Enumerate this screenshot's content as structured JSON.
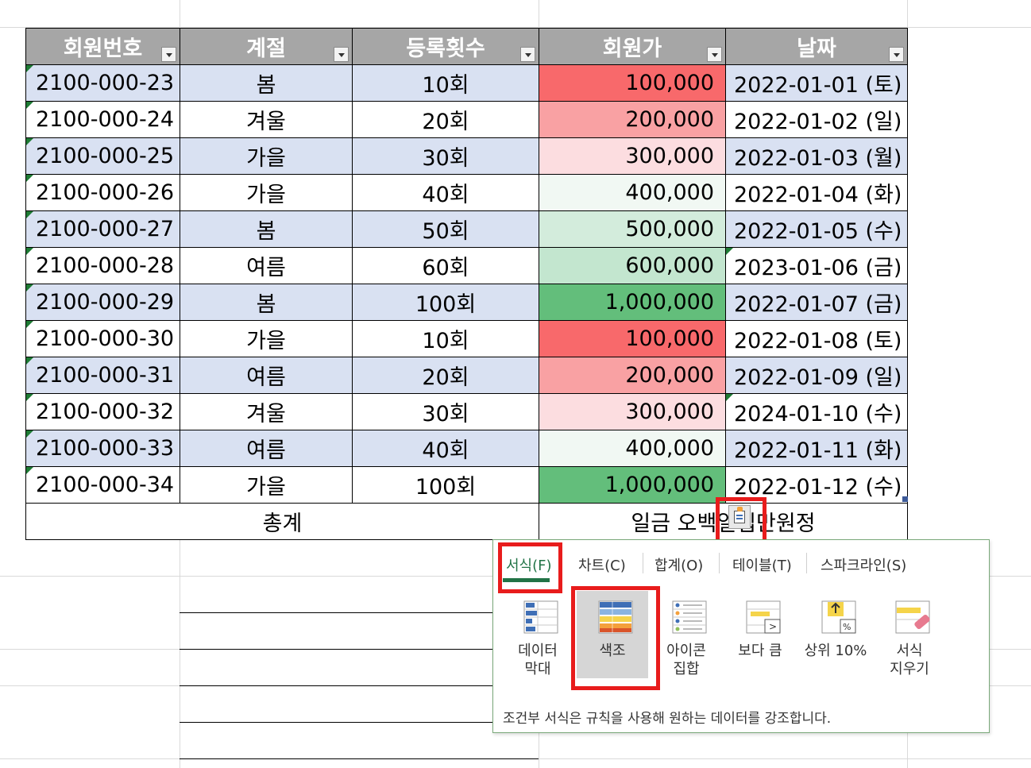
{
  "table": {
    "headers": [
      "회원번호",
      "계절",
      "등록횟수",
      "회원가",
      "날짜"
    ],
    "rows": [
      {
        "id": "2100-000-23",
        "season": "봄",
        "count": "10회",
        "price": "100,000",
        "date": "2022-01-01 (토)"
      },
      {
        "id": "2100-000-24",
        "season": "겨울",
        "count": "20회",
        "price": "200,000",
        "date": "2022-01-02 (일)"
      },
      {
        "id": "2100-000-25",
        "season": "가을",
        "count": "30회",
        "price": "300,000",
        "date": "2022-01-03 (월)"
      },
      {
        "id": "2100-000-26",
        "season": "가을",
        "count": "40회",
        "price": "400,000",
        "date": "2022-01-04 (화)"
      },
      {
        "id": "2100-000-27",
        "season": "봄",
        "count": "50회",
        "price": "500,000",
        "date": "2022-01-05 (수)"
      },
      {
        "id": "2100-000-28",
        "season": "여름",
        "count": "60회",
        "price": "600,000",
        "date": "2023-01-06 (금)"
      },
      {
        "id": "2100-000-29",
        "season": "봄",
        "count": "100회",
        "price": "1,000,000",
        "date": "2022-01-07 (금)"
      },
      {
        "id": "2100-000-30",
        "season": "가을",
        "count": "10회",
        "price": "100,000",
        "date": "2022-01-08 (토)"
      },
      {
        "id": "2100-000-31",
        "season": "여름",
        "count": "20회",
        "price": "200,000",
        "date": "2022-01-09 (일)"
      },
      {
        "id": "2100-000-32",
        "season": "겨울",
        "count": "30회",
        "price": "300,000",
        "date": "2024-01-10 (수)"
      },
      {
        "id": "2100-000-33",
        "season": "여름",
        "count": "40회",
        "price": "400,000",
        "date": "2022-01-11 (화)"
      },
      {
        "id": "2100-000-34",
        "season": "가을",
        "count": "100회",
        "price": "1,000,000",
        "date": "2022-01-12 (수)"
      }
    ],
    "total_label": "총계",
    "total_value": "일금 오백일십만원정"
  },
  "color_scale": {
    "100,000": "#f8696b",
    "200,000": "#f9a1a3",
    "300,000": "#fcdde0",
    "400,000": "#f1f8f3",
    "500,000": "#d3ecdc",
    "600,000": "#c3e6cf",
    "1,000,000": "#63be7b"
  },
  "colors": {
    "header_bg": "#a6a6a6",
    "band": "#d9e1f2",
    "accent_green": "#217346",
    "highlight_red": "#e81c1c"
  },
  "quick_analysis": {
    "trigger_icon": "quick-analysis-icon",
    "tabs": [
      {
        "label": "서식(F)",
        "active": true
      },
      {
        "label": "차트(C)"
      },
      {
        "label": "합계(O)"
      },
      {
        "label": "테이블(T)"
      },
      {
        "label": "스파크라인(S)"
      }
    ],
    "options": [
      {
        "label": "데이터 막대",
        "icon": "data-bars-icon"
      },
      {
        "label": "색조",
        "icon": "color-scale-icon",
        "selected": true
      },
      {
        "label": "아이콘 집합",
        "icon": "icon-set-icon"
      },
      {
        "label": "보다 큼",
        "icon": "greater-than-icon"
      },
      {
        "label": "상위 10%",
        "icon": "top-10-icon"
      },
      {
        "label": "서식 지우기",
        "icon": "clear-format-icon"
      }
    ],
    "description": "조건부 서식은 규칙을 사용해 원하는 데이터를 강조합니다."
  }
}
